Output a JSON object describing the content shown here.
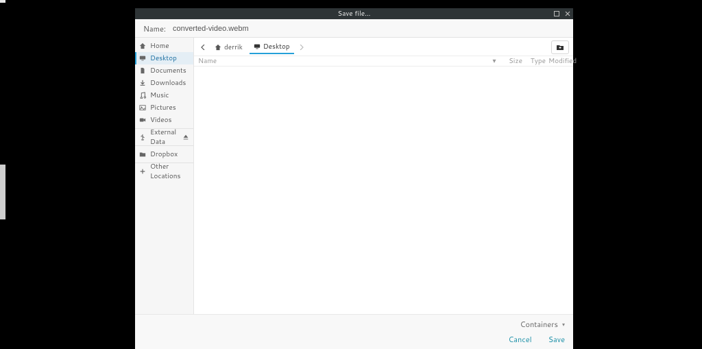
{
  "dialog": {
    "title": "Save file..."
  },
  "name_row": {
    "label": "Name:",
    "value": "converted-video.webm"
  },
  "sidebar": {
    "places": [
      {
        "icon": "home-icon",
        "label": "Home"
      },
      {
        "icon": "screen-icon",
        "label": "Desktop",
        "active": true
      },
      {
        "icon": "doc-icon",
        "label": "Documents"
      },
      {
        "icon": "download-icon",
        "label": "Downloads"
      },
      {
        "icon": "music-icon",
        "label": "Music"
      },
      {
        "icon": "picture-icon",
        "label": "Pictures"
      },
      {
        "icon": "video-icon",
        "label": "Videos"
      }
    ],
    "devices": [
      {
        "icon": "usb-icon",
        "label": "External Data",
        "ejectable": true
      }
    ],
    "bookmarks": [
      {
        "icon": "folder-icon",
        "label": "Dropbox"
      }
    ],
    "other": [
      {
        "icon": "plus-icon",
        "label": "Other Locations"
      }
    ]
  },
  "pathbar": {
    "back": "◄",
    "forward": "►",
    "crumbs": [
      {
        "icon": "home-icon",
        "label": "derrik",
        "active": false
      },
      {
        "icon": "screen-icon",
        "label": "Desktop",
        "active": true
      }
    ]
  },
  "columns": {
    "name": "Name",
    "sort_indicator": "▾",
    "size": "Size",
    "type": "Type",
    "modified": "Modified"
  },
  "footer": {
    "filter_label": "Containers",
    "cancel": "Cancel",
    "save": "Save"
  },
  "colors": {
    "accent": "#25a0d8",
    "teal": "#1a8fa7"
  }
}
